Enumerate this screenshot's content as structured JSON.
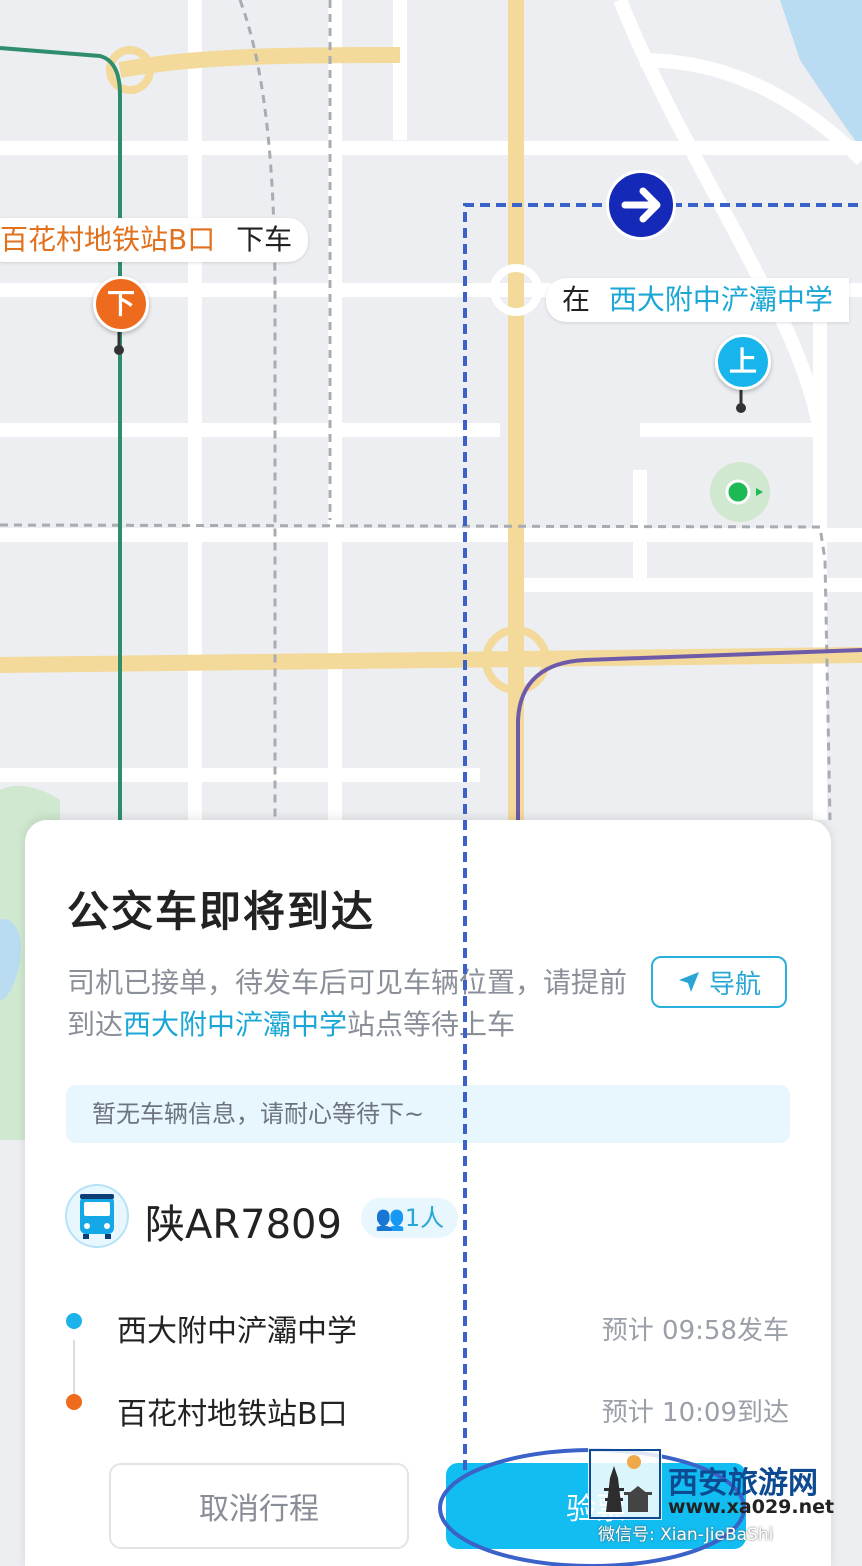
{
  "map": {
    "dropoff_label": "百花村地铁站B口",
    "dropoff_action": "下车",
    "dropoff_pin": "下",
    "pickup_prefix": "在",
    "pickup_label": "西大附中浐灞中学",
    "pickup_pin": "上",
    "route_color": "#3a62c9",
    "road_color": "#f3d99a"
  },
  "panel": {
    "title": "公交车即将到达",
    "desc_part1": "司机已接单，待发车后可见车辆位置，请提前到达",
    "desc_station": "西大附中浐灞中学",
    "desc_part2": "站点等待上车",
    "nav_button": "导航",
    "notice": "暂无车辆信息，请耐心等待下~",
    "plate": "陕AR7809",
    "passengers": "1人",
    "stops": [
      {
        "name": "西大附中浐灞中学",
        "time": "预计 09:58发车",
        "color": "#1cb3ea"
      },
      {
        "name": "百花村地铁站B口",
        "time": "预计 10:09到达",
        "color": "#ee6a1c"
      }
    ],
    "cancel_button": "取消行程",
    "ticket_button": "验票"
  },
  "watermark": {
    "site_name": "西安旅游网",
    "url": "www.xa029.net",
    "wechat": "微信号: Xian-JieBaShi"
  }
}
